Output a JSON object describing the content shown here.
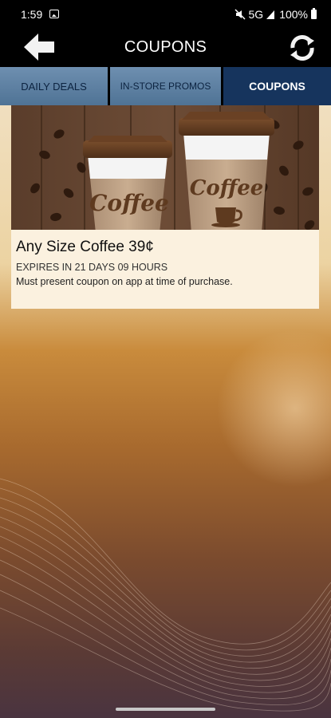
{
  "status_bar": {
    "time": "1:59",
    "network": "5G",
    "battery": "100%",
    "icons": [
      "gallery-icon",
      "mute-icon",
      "signal-icon",
      "battery-icon"
    ]
  },
  "header": {
    "title": "COUPONS",
    "back_icon": "back-arrow-icon",
    "refresh_icon": "refresh-icon"
  },
  "tabs": [
    {
      "label": "DAILY DEALS",
      "active": false
    },
    {
      "label": "IN-STORE PROMOS",
      "active": false
    },
    {
      "label": "COUPONS",
      "active": true
    }
  ],
  "coupon": {
    "title": "Any Size Coffee 39¢",
    "expiry": "EXPIRES IN 21 DAYS 09 HOURS",
    "note": "Must present coupon on app at time of purchase.",
    "cup_text": "Coffee"
  },
  "colors": {
    "tab_inactive": "#5a7fa3",
    "tab_active": "#16345d",
    "header_bg": "#000000"
  }
}
